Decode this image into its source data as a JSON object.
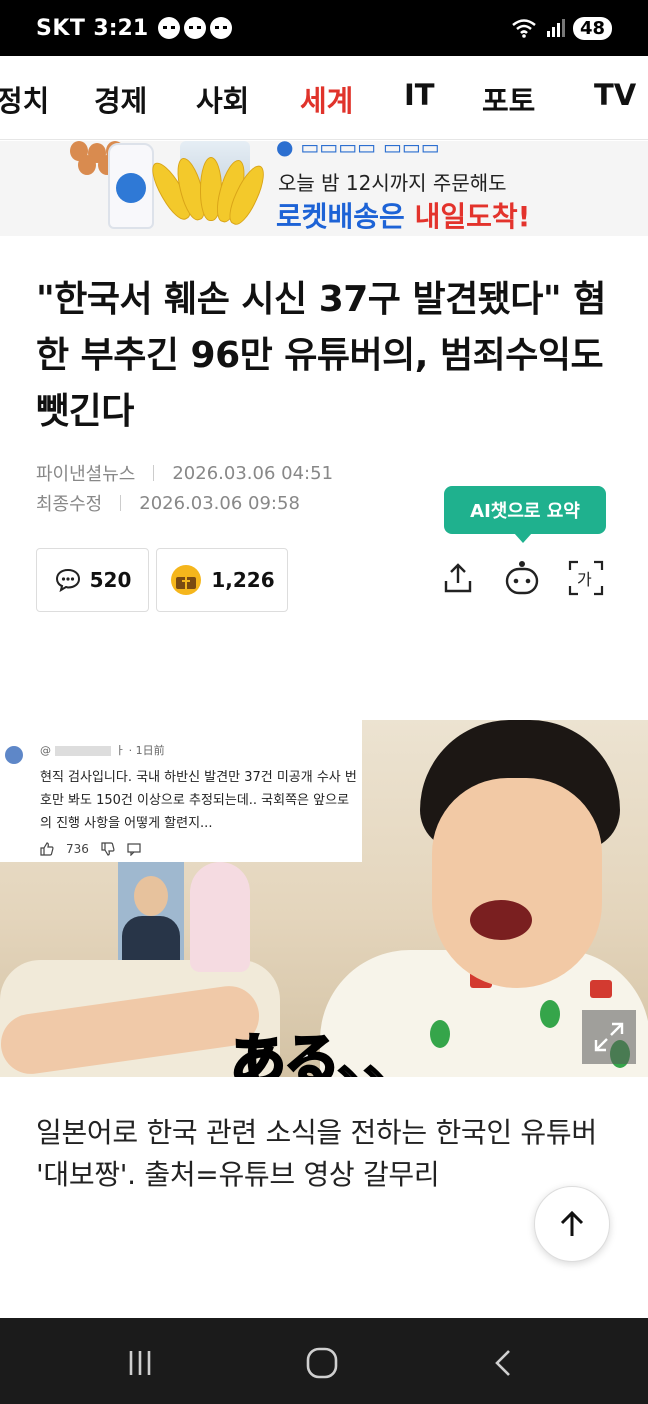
{
  "status_bar": {
    "carrier": "SKT",
    "time": "3:21",
    "notifications": [
      "talk-icon",
      "chat-icon",
      "message-icon"
    ],
    "battery": "48"
  },
  "category_nav": {
    "items": [
      {
        "label": "정치",
        "active": false
      },
      {
        "label": "경제",
        "active": false
      },
      {
        "label": "사회",
        "active": false
      },
      {
        "label": "세계",
        "active": true
      },
      {
        "label": "IT",
        "active": false
      },
      {
        "label": "포토",
        "active": false
      },
      {
        "label": "TV",
        "active": false
      }
    ],
    "active_color": "#e0332b"
  },
  "ad_banner": {
    "line1": "오늘 밤 12시까지 주문해도",
    "line2_blue": "로켓배송은 ",
    "line2_red": "내일도착!"
  },
  "article": {
    "headline": "\"한국서 훼손 시신 37구 발견됐다\" 혐한 부추긴 96만 유튜버의, 범죄수익도 뺏긴다",
    "source": "파이낸셜뉴스",
    "published": "2026.03.06 04:51",
    "modified_label": "최종수정",
    "modified": "2026.03.06 09:58",
    "ai_summary_label": "AI챗으로 요약",
    "comment_count": "520",
    "reaction_count": "1,226",
    "photo_overlay": {
      "comment_meta": "ㅏ · 1日前",
      "comment_text": "현직 검사입니다. 국내 하반신 발견만 37건 미공개 수사 번호만 봐도 150건 이상으로 추정되는데.. 국회쪽은 앞으로의 진행 사항을 어떻게 할련지...",
      "likes": "736",
      "subtitle": "ある、、"
    },
    "photo_caption": "일본어로 한국 관련 소식을 전하는 한국인 유튜버 '대보짱'. 출처=유튜브 영상 갈무리"
  },
  "colors": {
    "accent": "#1fb18e",
    "highlight": "#e0332b"
  }
}
